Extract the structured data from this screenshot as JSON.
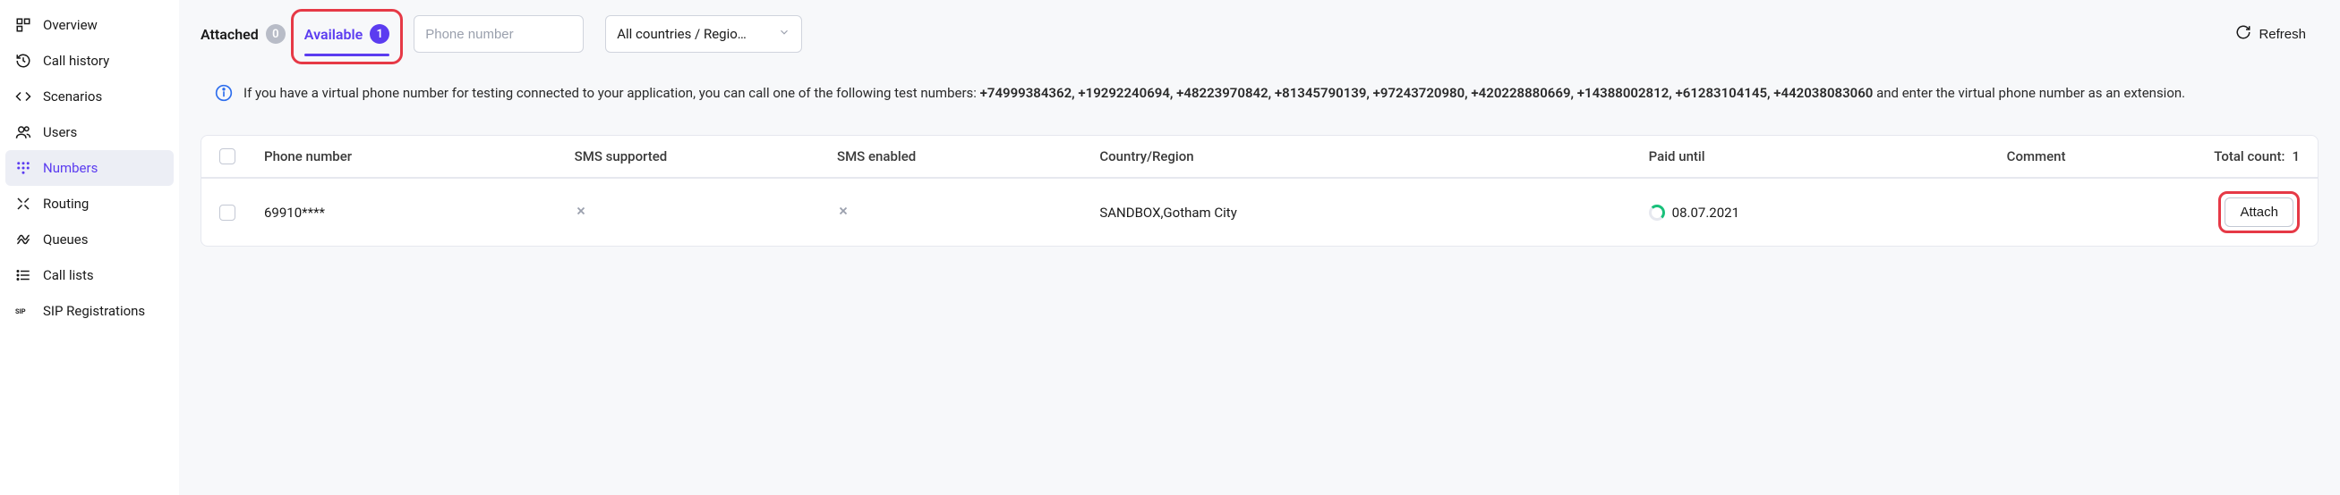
{
  "sidebar": {
    "items": [
      {
        "label": "Overview",
        "icon": "dashboard-icon"
      },
      {
        "label": "Call history",
        "icon": "history-icon"
      },
      {
        "label": "Scenarios",
        "icon": "code-icon"
      },
      {
        "label": "Users",
        "icon": "users-icon"
      },
      {
        "label": "Numbers",
        "icon": "dialpad-icon",
        "active": true
      },
      {
        "label": "Routing",
        "icon": "routing-icon"
      },
      {
        "label": "Queues",
        "icon": "queues-icon"
      },
      {
        "label": "Call lists",
        "icon": "list-icon"
      },
      {
        "label": "SIP Registrations",
        "icon": "sip-icon"
      }
    ]
  },
  "tabs": {
    "attached": {
      "label": "Attached",
      "count": "0"
    },
    "available": {
      "label": "Available",
      "count": "1"
    }
  },
  "filters": {
    "phone_placeholder": "Phone number",
    "country_selected": "All countries / Regio…"
  },
  "refresh_label": "Refresh",
  "info": {
    "text_before": "If you have a virtual phone number for testing connected to your application, you can call one of the following test numbers: ",
    "numbers": "+74999384362, +19292240694, +48223970842, +81345790139, +97243720980, +420228880669, +14388002812, +61283104145, +442038083060",
    "text_after": " and enter the virtual phone number as an extension."
  },
  "table": {
    "headers": {
      "phone": "Phone number",
      "sms_supported": "SMS supported",
      "sms_enabled": "SMS enabled",
      "country": "Country/Region",
      "paid_until": "Paid until",
      "comment": "Comment",
      "total_count_label": "Total count: ",
      "total_count_value": "1"
    },
    "rows": [
      {
        "phone": "69910****",
        "sms_supported": false,
        "sms_enabled": false,
        "country": "SANDBOX,Gotham City",
        "paid_until": "08.07.2021",
        "comment": "",
        "action_label": "Attach"
      }
    ]
  }
}
